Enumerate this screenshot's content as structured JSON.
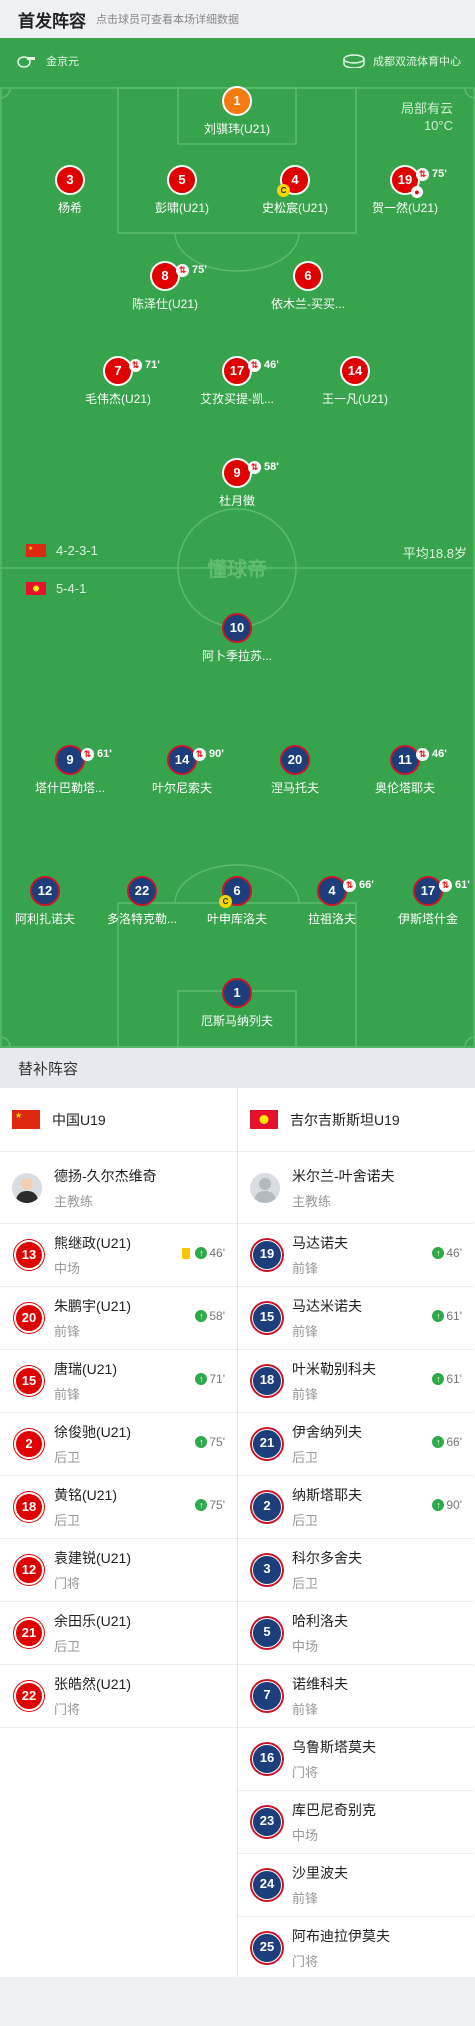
{
  "header": {
    "title": "首发阵容",
    "subtitle": "点击球员可查看本场详细数据"
  },
  "match": {
    "referee": "金京元",
    "venue": "成都双流体育中心",
    "weather": "局部有云",
    "temperature": "10°C",
    "watermark": "懂球帝",
    "avg_age": "平均18.8岁"
  },
  "home": {
    "formation": "4-2-3-1",
    "name": "中国U19",
    "coach": {
      "name": "德扬-久尔杰维奇",
      "role": "主教练"
    },
    "lineup": [
      {
        "num": "1",
        "name": "刘骐玮(U21)",
        "gk": true
      },
      {
        "num": "3",
        "name": "杨希"
      },
      {
        "num": "5",
        "name": "彭啸(U21)"
      },
      {
        "num": "4",
        "name": "史松宸(U21)",
        "captain": true
      },
      {
        "num": "19",
        "name": "贺一然(U21)",
        "sub_min": "75'",
        "goal": true
      },
      {
        "num": "8",
        "name": "陈泽仕(U21)",
        "sub_min": "75'"
      },
      {
        "num": "6",
        "name": "依木兰-买买..."
      },
      {
        "num": "7",
        "name": "毛伟杰(U21)",
        "sub_min": "71'"
      },
      {
        "num": "17",
        "name": "艾孜买提-凯...",
        "sub_min": "46'"
      },
      {
        "num": "14",
        "name": "王一凡(U21)"
      },
      {
        "num": "9",
        "name": "杜月徵",
        "sub_min": "58'"
      }
    ],
    "subs": [
      {
        "num": "13",
        "name": "熊继政(U21)",
        "pos": "中场",
        "min": "46'",
        "yellow": true
      },
      {
        "num": "20",
        "name": "朱鹏宇(U21)",
        "pos": "前锋",
        "min": "58'"
      },
      {
        "num": "15",
        "name": "唐瑞(U21)",
        "pos": "前锋",
        "min": "71'"
      },
      {
        "num": "2",
        "name": "徐俊驰(U21)",
        "pos": "后卫",
        "min": "75'"
      },
      {
        "num": "18",
        "name": "黄铭(U21)",
        "pos": "后卫",
        "min": "75'"
      },
      {
        "num": "12",
        "name": "袁建锐(U21)",
        "pos": "门将"
      },
      {
        "num": "21",
        "name": "余田乐(U21)",
        "pos": "后卫"
      },
      {
        "num": "22",
        "name": "张皓然(U21)",
        "pos": "门将"
      }
    ]
  },
  "away": {
    "formation": "5-4-1",
    "name": "吉尔吉斯斯坦U19",
    "coach": {
      "name": "米尔兰-叶舍诺夫",
      "role": "主教练"
    },
    "lineup": [
      {
        "num": "10",
        "name": "阿卜季拉苏..."
      },
      {
        "num": "9",
        "name": "塔什巴勒塔...",
        "sub_min": "61'"
      },
      {
        "num": "14",
        "name": "叶尔尼索夫",
        "sub_min": "90'"
      },
      {
        "num": "20",
        "name": "涅马托夫"
      },
      {
        "num": "11",
        "name": "奥伦塔耶夫",
        "sub_min": "46'"
      },
      {
        "num": "12",
        "name": "阿利扎诺夫"
      },
      {
        "num": "22",
        "name": "多洛特克勒..."
      },
      {
        "num": "6",
        "name": "叶申库洛夫",
        "captain": true
      },
      {
        "num": "4",
        "name": "拉祖洛夫",
        "sub_min": "66'"
      },
      {
        "num": "17",
        "name": "伊斯塔什金",
        "sub_min": "61'"
      },
      {
        "num": "1",
        "name": "厄斯马纳列夫",
        "gk": true
      }
    ],
    "subs": [
      {
        "num": "19",
        "name": "马达诺夫",
        "pos": "前锋",
        "min": "46'"
      },
      {
        "num": "15",
        "name": "马达米诺夫",
        "pos": "前锋",
        "min": "61'"
      },
      {
        "num": "18",
        "name": "叶米勒别科夫",
        "pos": "前锋",
        "min": "61'"
      },
      {
        "num": "21",
        "name": "伊舍纳列夫",
        "pos": "后卫",
        "min": "66'"
      },
      {
        "num": "2",
        "name": "纳斯塔耶夫",
        "pos": "后卫",
        "min": "90'"
      },
      {
        "num": "3",
        "name": "科尔多舍夫",
        "pos": "后卫"
      },
      {
        "num": "5",
        "name": "哈利洛夫",
        "pos": "中场"
      },
      {
        "num": "7",
        "name": "诺维科夫",
        "pos": "前锋"
      },
      {
        "num": "16",
        "name": "乌鲁斯塔莫夫",
        "pos": "门将"
      },
      {
        "num": "23",
        "name": "库巴尼奇别克",
        "pos": "中场"
      },
      {
        "num": "24",
        "name": "沙里波夫",
        "pos": "前锋"
      },
      {
        "num": "25",
        "name": "阿布迪拉伊莫夫",
        "pos": "门将"
      }
    ]
  },
  "subs_section": {
    "title": "替补阵容"
  },
  "colors": {
    "pitch": "#37a34c",
    "home": "#e00000",
    "away": "#1c3e7a",
    "away_ring": "#c9152a",
    "gk_home": "#f57a13"
  },
  "icons": {
    "referee": "whistle-icon",
    "venue": "stadium-icon",
    "sub": "substitution-icon",
    "sub_in": "sub-in-arrow-icon",
    "captain": "captain-badge-icon",
    "goal": "football-icon",
    "yellow": "yellow-card-icon"
  }
}
